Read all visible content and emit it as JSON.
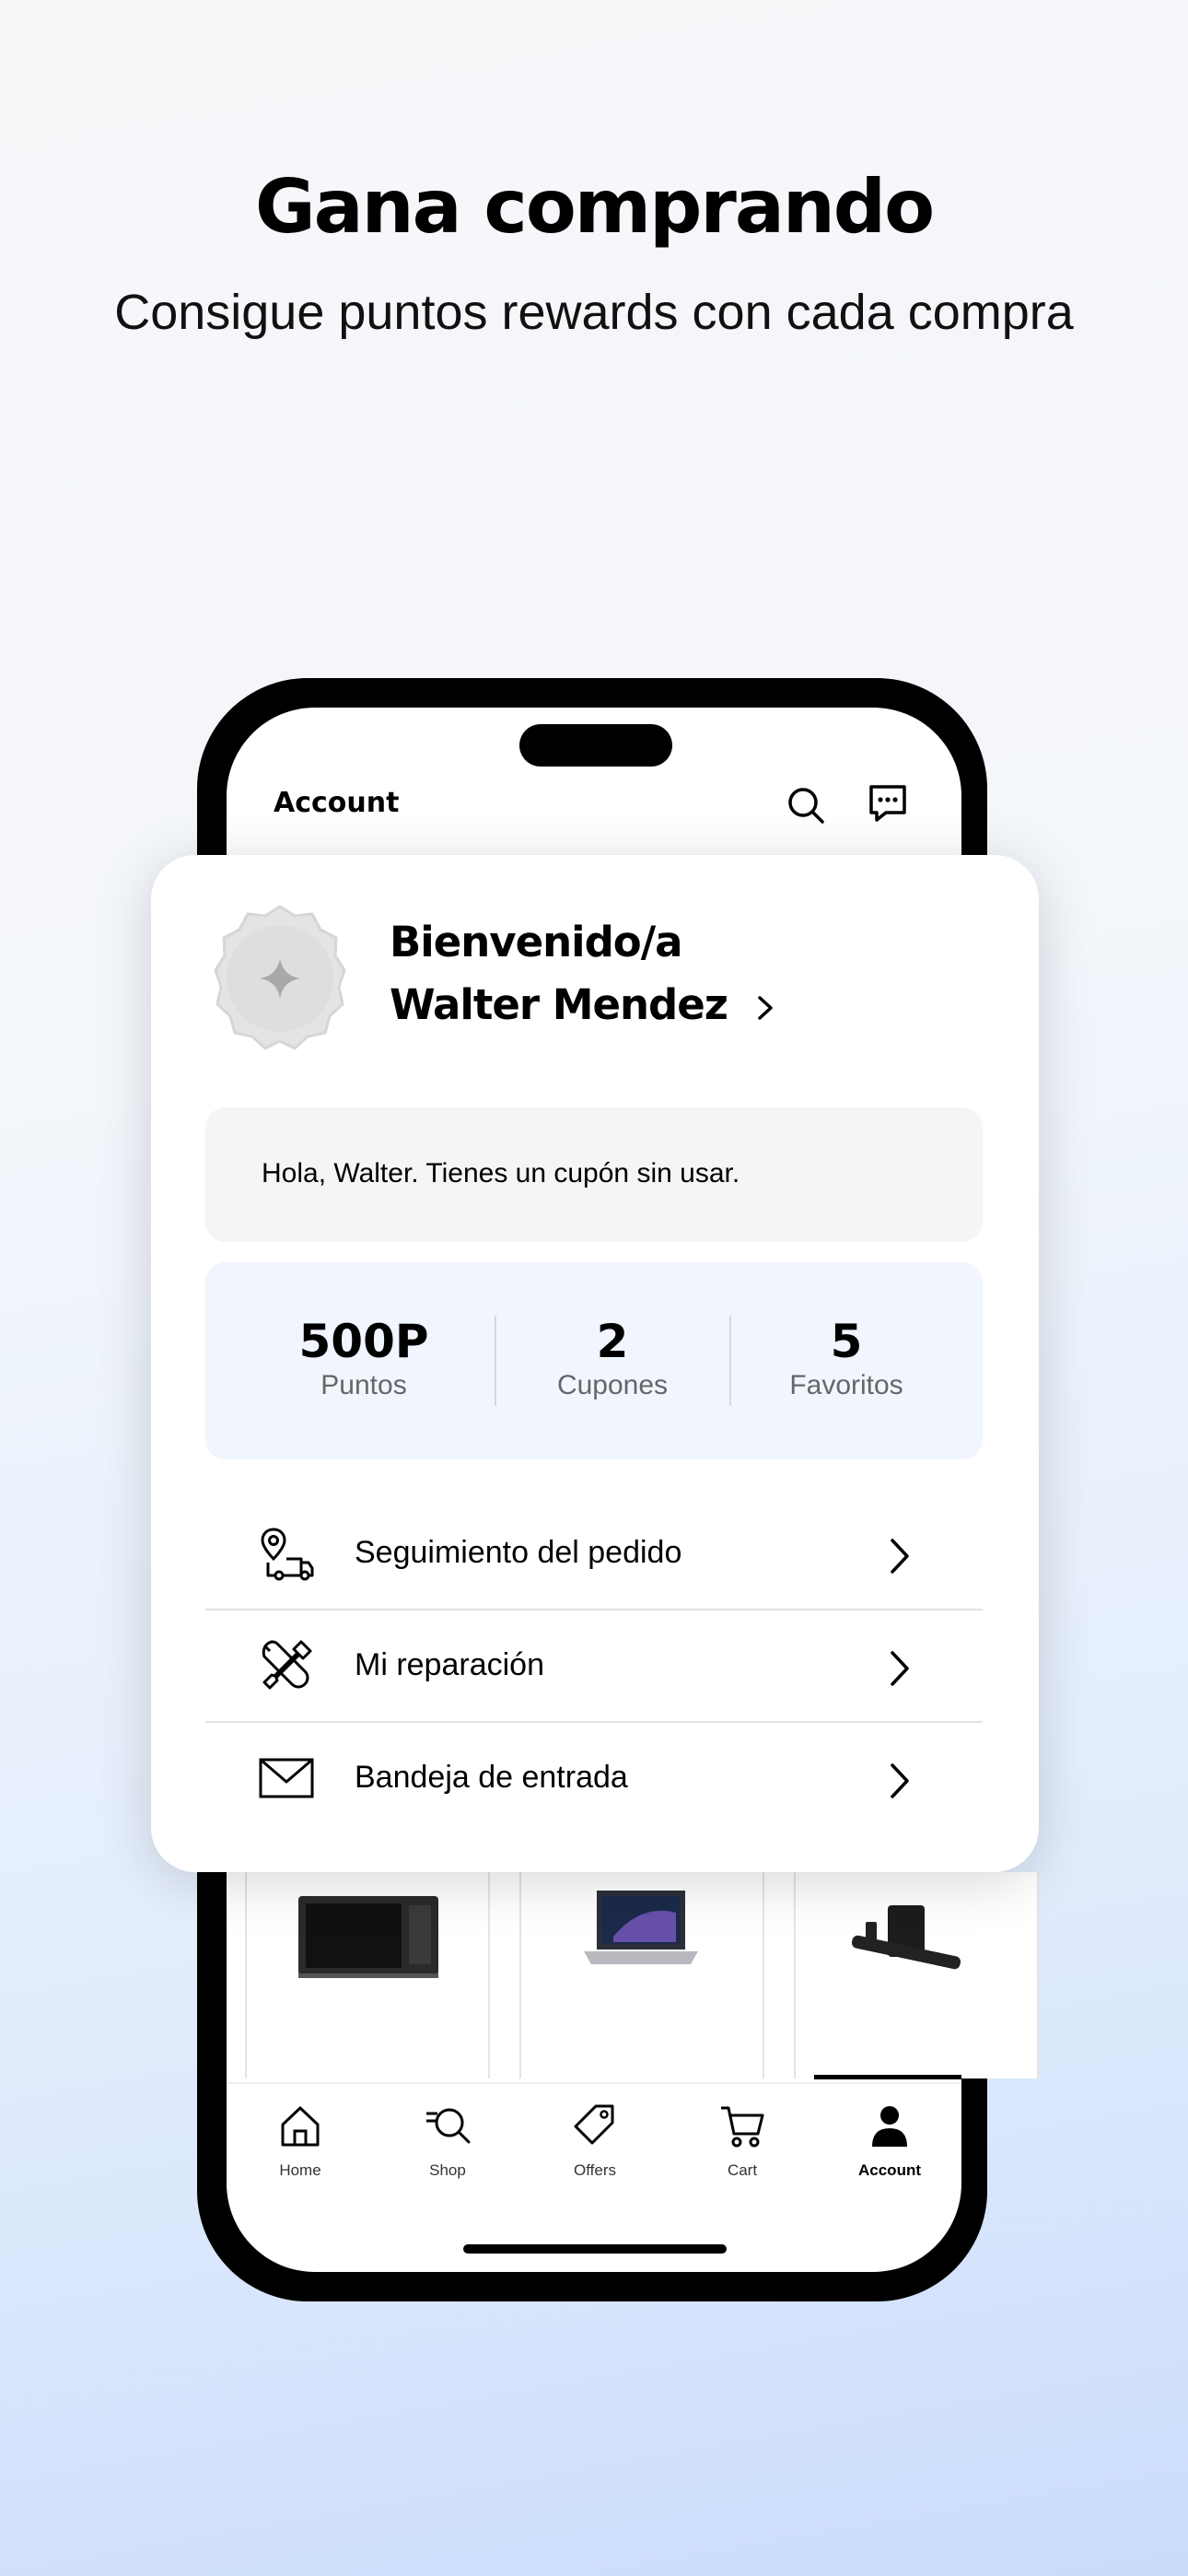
{
  "promo": {
    "headline": "Gana comprando",
    "subline": "Consigue puntos rewards con cada compra"
  },
  "app": {
    "screen_title": "Account",
    "header_icons": [
      "search-icon",
      "chat-icon"
    ]
  },
  "profile": {
    "greeting": "Bienvenido/a",
    "name": "Walter Mendez",
    "avatar_icon": "sparkle-badge-icon"
  },
  "notice": "Hola, Walter. Tienes un cupón sin usar.",
  "stats": [
    {
      "value": "500P",
      "label": "Puntos"
    },
    {
      "value": "2",
      "label": "Cupones"
    },
    {
      "value": "5",
      "label": "Favoritos"
    }
  ],
  "menu": [
    {
      "label": "Seguimiento del pedido",
      "icon": "delivery-truck-location-icon"
    },
    {
      "label": "Mi reparación",
      "icon": "repair-tools-icon"
    },
    {
      "label": "Bandeja de entrada",
      "icon": "envelope-icon"
    }
  ],
  "products": [
    "microwave",
    "laptop",
    "soundbar"
  ],
  "tabs": [
    {
      "label": "Home",
      "icon": "home-icon"
    },
    {
      "label": "Shop",
      "icon": "shop-search-icon"
    },
    {
      "label": "Offers",
      "icon": "tag-icon"
    },
    {
      "label": "Cart",
      "icon": "cart-icon"
    },
    {
      "label": "Account",
      "icon": "account-icon",
      "active": true
    }
  ],
  "colors": {
    "background_gradient_end": "#cadcfb",
    "stats_background": "#f1f5fe",
    "notice_background": "#f5f5f5"
  }
}
